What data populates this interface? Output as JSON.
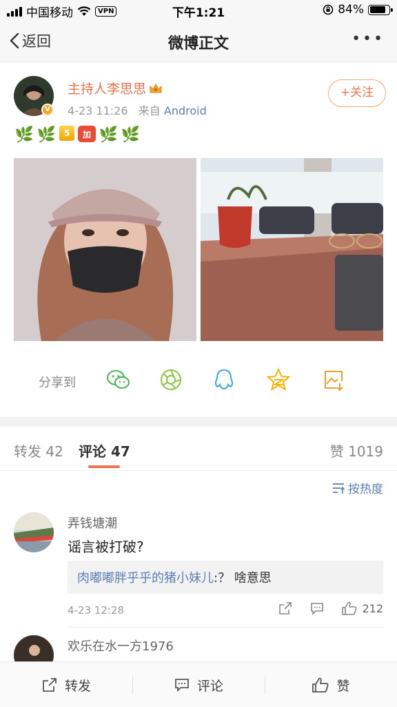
{
  "status_bar": {
    "carrier": "中国移动",
    "vpn": "VPN",
    "time": "下午1:21",
    "battery": "84%",
    "battery_level": 0.84
  },
  "nav": {
    "back_label": "返回",
    "title": "微博正文",
    "more": "•••"
  },
  "post": {
    "author": "主持人李思思",
    "date": "4-23 11:26",
    "source_prefix": "来自",
    "source": "Android",
    "follow_label": "+关注",
    "emojis": [
      "🌿",
      "🌿",
      "5",
      "加",
      "🌿",
      "🌿"
    ]
  },
  "share": {
    "label": "分享到",
    "icons": [
      "wechat-icon",
      "moments-icon",
      "qq-icon",
      "qzone-icon",
      "save-image-icon"
    ]
  },
  "tabs": {
    "repost": "转发 42",
    "comment": "评论 47",
    "like": "赞 1019"
  },
  "sort": {
    "label": "按热度"
  },
  "comments": [
    {
      "name": "弄钱塘潮",
      "text": "谣言被打破?",
      "reply_name": "肉嘟嘟胖乎乎的猪小妹儿",
      "reply_text": ":？ 啥意思",
      "time": "4-23 12:28",
      "likes": "212"
    },
    {
      "name": "欢乐在水一方1976"
    }
  ],
  "bottom_bar": {
    "repost": "转发",
    "comment": "评论",
    "like": "赞"
  },
  "colors": {
    "accent": "#eb7350",
    "link": "#5a7fb5"
  }
}
